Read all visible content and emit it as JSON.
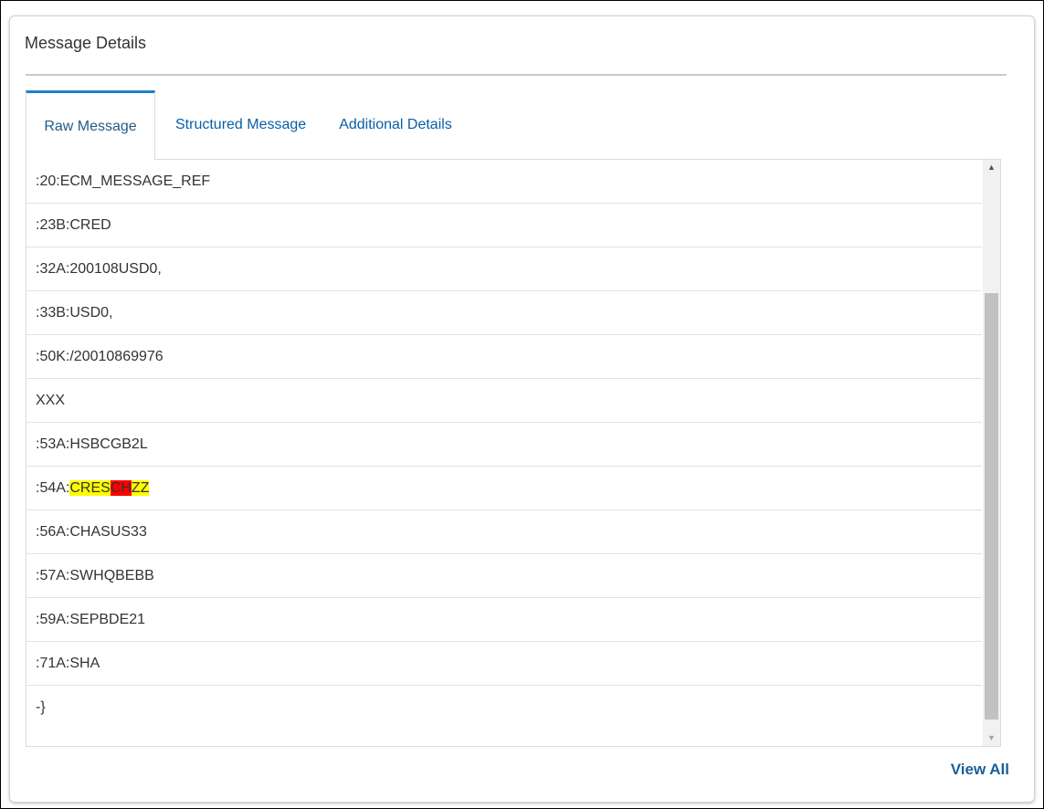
{
  "panel": {
    "title": "Message Details"
  },
  "tabs": [
    {
      "label": "Raw Message",
      "active": true
    },
    {
      "label": "Structured Message",
      "active": false
    },
    {
      "label": "Additional Details",
      "active": false
    }
  ],
  "raw_message": {
    "lines": [
      ":20:ECM_MESSAGE_REF",
      ":23B:CRED",
      ":32A:200108USD0,",
      ":33B:USD0,",
      ":50K:/20010869976",
      "XXX",
      ":53A:HSBCGB2L",
      ":54A:CRESCHZZ",
      ":56A:CHASUS33",
      ":57A:SWHQBEBB",
      ":59A:SEPBDE21",
      ":71A:SHA",
      "-}"
    ],
    "highlighted_line": {
      "prefix": ":54A:",
      "yellow_1": "CRES",
      "red": "CH",
      "yellow_2": "ZZ"
    }
  },
  "scrollbar": {
    "up_icon": "triangle-up-icon",
    "down_icon": "triangle-down-icon"
  },
  "footer": {
    "view_all_label": "View All"
  },
  "colors": {
    "link": "#1a5f99",
    "tab_active_border": "#1e7ec8",
    "highlight_yellow": "#ffff00",
    "highlight_red": "#ff0000"
  }
}
